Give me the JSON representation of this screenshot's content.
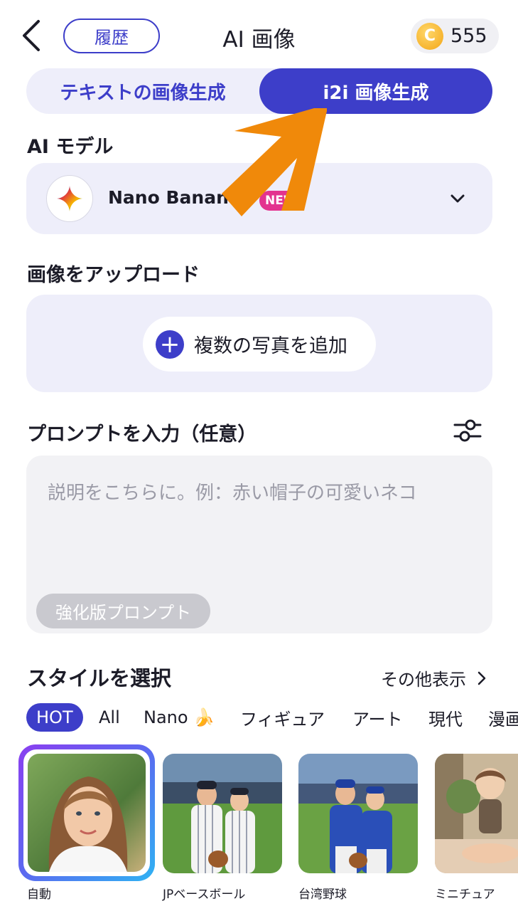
{
  "header": {
    "back_icon": "chevron-left-icon",
    "history_label": "履歴",
    "title": "AI 画像",
    "coin_symbol": "C",
    "coin_count": "555"
  },
  "mode_tabs": [
    {
      "label": "テキストの画像生成",
      "active": false
    },
    {
      "label": "i2i 画像生成",
      "active": true
    }
  ],
  "model": {
    "section_label": "AI モデル",
    "name": "Nano Banana",
    "badge": "NEW",
    "icon": "gemini-sparkle-icon"
  },
  "upload": {
    "section_label": "画像をアップロード",
    "button_label": "複数の写真を追加"
  },
  "prompt": {
    "section_label": "プロンプトを入力（任意）",
    "placeholder": "説明をこちらに。例：赤い帽子の可愛いネコ",
    "enhance_label": "強化版プロンプト",
    "settings_icon": "sliders-icon"
  },
  "styles": {
    "section_label": "スタイルを選択",
    "more_label": "その他表示",
    "categories": [
      "HOT",
      "All",
      "Nano 🍌",
      "フィギュア",
      "アート",
      "現代",
      "漫画"
    ],
    "active_category": "HOT",
    "cards": [
      {
        "label": "自動",
        "selected": true
      },
      {
        "label": "JPベースボール",
        "selected": false
      },
      {
        "label": "台湾野球",
        "selected": false
      },
      {
        "label": "ミニチュア",
        "selected": false
      }
    ]
  },
  "colors": {
    "accent": "#3d3ec9",
    "panel": "#eeeefa",
    "annotation_arrow": "#f0890a"
  }
}
